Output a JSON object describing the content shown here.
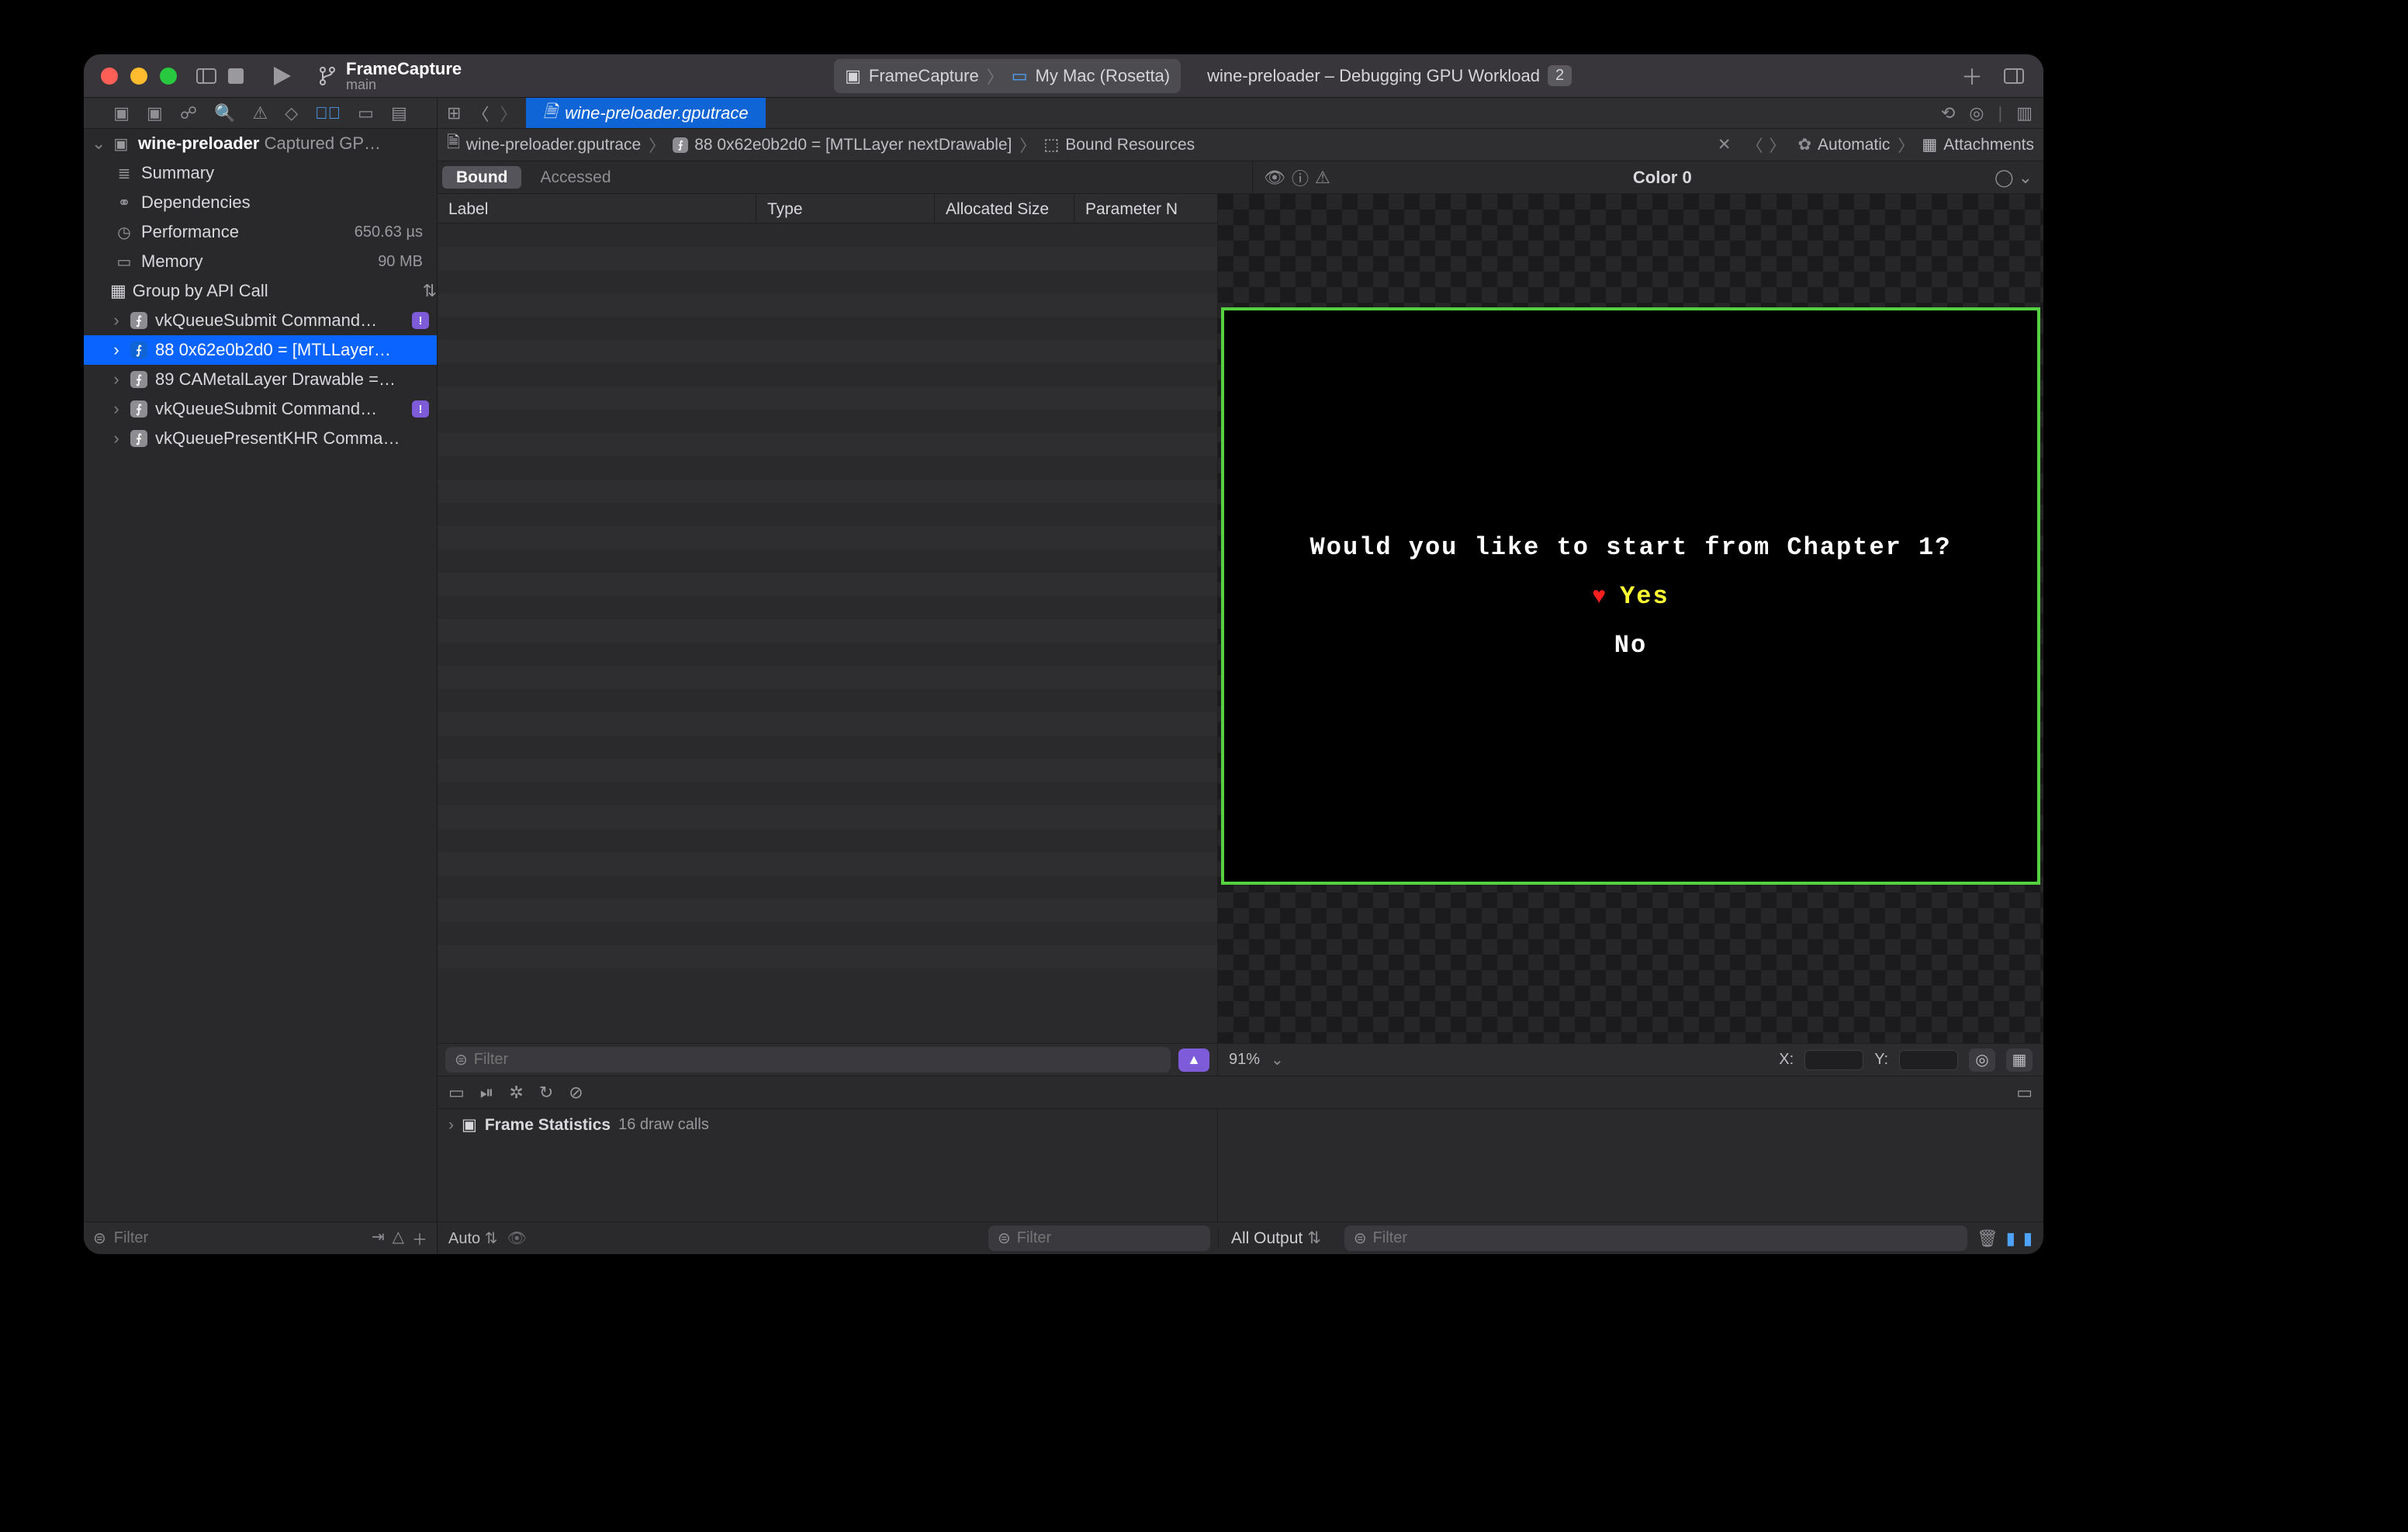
{
  "titlebar": {
    "scheme_name": "FrameCapture",
    "scheme_branch": "main",
    "crumb_project": "FrameCapture",
    "crumb_target": "My Mac (Rosetta)",
    "activity_text": "wine-preloader – Debugging GPU Workload",
    "activity_badge": "2",
    "plus": "+"
  },
  "doctab": {
    "filename": "wine-preloader.gputrace"
  },
  "pathbar": {
    "p1": "wine-preloader.gputrace",
    "p2": "88 0x62e0b2d0 = [MTLLayer nextDrawable]",
    "p3": "Bound Resources",
    "auto": "Automatic",
    "attach": "Attachments"
  },
  "resbar": {
    "bound": "Bound",
    "accessed": "Accessed",
    "color_title": "Color 0"
  },
  "columns": {
    "label": "Label",
    "type": "Type",
    "alloc": "Allocated Size",
    "param": "Parameter N"
  },
  "nav": {
    "root": "wine-preloader",
    "root_sub": "Captured GP…",
    "summary": "Summary",
    "deps": "Dependencies",
    "perf": "Performance",
    "perf_val": "650.63 µs",
    "mem": "Memory",
    "mem_val": "90 MB",
    "group": "Group by API Call",
    "c1": "vkQueueSubmit Command…",
    "c2": "88 0x62e0b2d0 = [MTLLayer…",
    "c3": "89 CAMetalLayer Drawable =…",
    "c4": "vkQueueSubmit Command…",
    "c5": "vkQueuePresentKHR Comma…"
  },
  "filter": {
    "placeholder": "Filter"
  },
  "viewer": {
    "zoom": "91%",
    "xlabel": "X:",
    "ylabel": "Y:"
  },
  "game": {
    "question": "Would you like to start from Chapter 1?",
    "yes": "Yes",
    "no": "No"
  },
  "debug": {
    "frame_stats": "Frame Statistics",
    "draw_calls": "16 draw calls",
    "auto": "Auto",
    "all_output": "All Output"
  }
}
